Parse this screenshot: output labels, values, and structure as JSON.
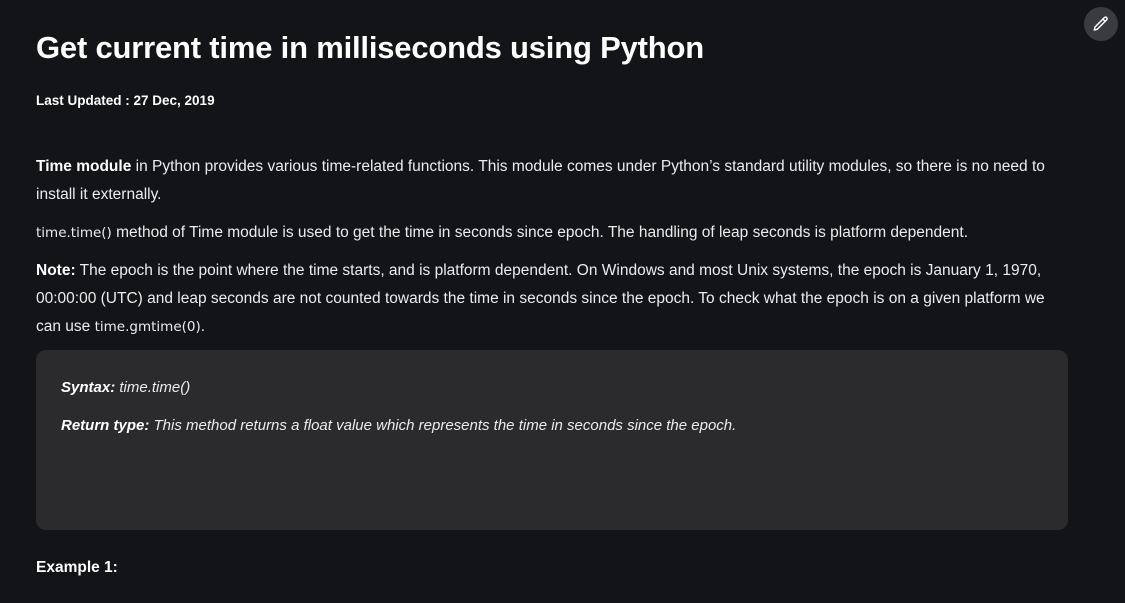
{
  "article": {
    "title": "Get current time in milliseconds using Python",
    "last_updated": "Last Updated : 27 Dec, 2019",
    "paragraph1": {
      "bold": "Time module",
      "text": " in Python provides various time-related functions. This module comes under Python’s standard utility modules, so there is no need to install it externally."
    },
    "paragraph2": {
      "code": "time.time()",
      "text": " method of Time module is used to get the time in seconds since epoch. The handling of leap seconds is platform dependent."
    },
    "paragraph3": {
      "bold": "Note:",
      "text": " The epoch is the point where the time starts, and is platform dependent. On Windows and most Unix systems, the epoch is January 1, 1970, 00:00:00 (UTC) and leap seconds are not counted towards the time in seconds since the epoch. To check what the epoch is on a given platform we can use ",
      "code": "time.gmtime(0)",
      "end": "."
    },
    "syntax_box": {
      "syntax_label": "Syntax:",
      "syntax_value": " time.time()",
      "return_label": "Return type:",
      "return_value": " This method returns a float value which represents the time in seconds since the epoch."
    },
    "example_heading": "Example 1:"
  },
  "edit_button": {
    "icon": "pencil-icon"
  }
}
